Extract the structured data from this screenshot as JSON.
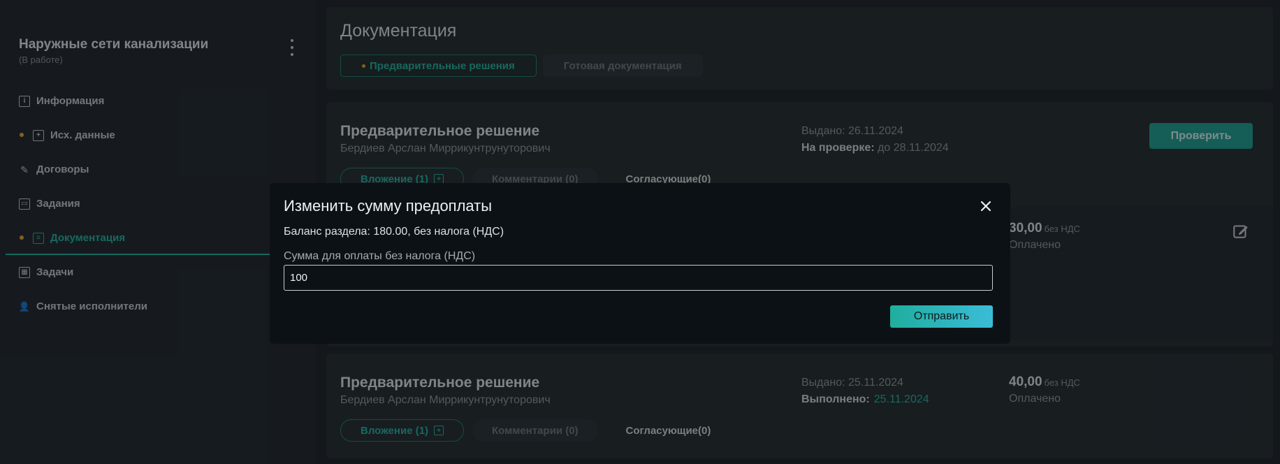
{
  "sidebar": {
    "project_title": "Наружные сети канализации",
    "project_status": "(В работе)",
    "items": [
      {
        "label": "Информация",
        "icon": "info-icon",
        "dot": false,
        "active": false
      },
      {
        "label": "Исх. данные",
        "icon": "plus-box-icon",
        "dot": true,
        "active": false
      },
      {
        "label": "Договоры",
        "icon": "pen-icon",
        "dot": false,
        "active": false
      },
      {
        "label": "Задания",
        "icon": "window-icon",
        "dot": false,
        "active": false
      },
      {
        "label": "Документация",
        "icon": "document-icon",
        "dot": true,
        "active": true
      },
      {
        "label": "Задачи",
        "icon": "grid-icon",
        "dot": false,
        "active": false
      },
      {
        "label": "Снятые исполнители",
        "icon": "user-remove-icon",
        "dot": false,
        "active": false
      }
    ]
  },
  "documentation": {
    "title": "Документация",
    "tabs": [
      {
        "label": "Предварительные решения",
        "active": true
      },
      {
        "label": "Готовая документация",
        "active": false
      }
    ]
  },
  "cards": [
    {
      "title": "Предварительное решение",
      "author": "Бердиев Арслан Миррикунтрунуторович",
      "issued": "Выдано: 26.11.2024",
      "status_label": "На проверке:",
      "status_value": "до 28.11.2024",
      "action_label": "Проверить",
      "attachment_label": "Вложение (1)",
      "comments_label": "Комментарии (0)",
      "approvers_label": "Согласующие(0)",
      "amount": "30,00",
      "amount_suffix": "без НДС",
      "paid_label": "Оплачено"
    },
    {
      "title": "Предварительное решение",
      "author": "Бердиев Арслан Миррикунтрунуторович",
      "issued": "Выдано: 25.11.2024",
      "status_label": "Выполнено:",
      "status_value": "25.11.2024",
      "attachment_label": "Вложение (1)",
      "comments_label": "Комментарии (0)",
      "approvers_label": "Согласующие(0)",
      "amount": "40,00",
      "amount_suffix": "без НДС",
      "paid_label": "Оплачено"
    }
  ],
  "modal": {
    "title": "Изменить сумму предоплаты",
    "balance": "Баланс раздела: 180.00, без налога (НДС)",
    "field_label": "Сумма для оплаты без налога (НДС)",
    "field_value": "100",
    "submit_label": "Отправить"
  },
  "colors": {
    "accent": "#23b3a3",
    "dot": "#e3a72f",
    "background": "#1c2227",
    "modal_background": "#0c1115"
  }
}
